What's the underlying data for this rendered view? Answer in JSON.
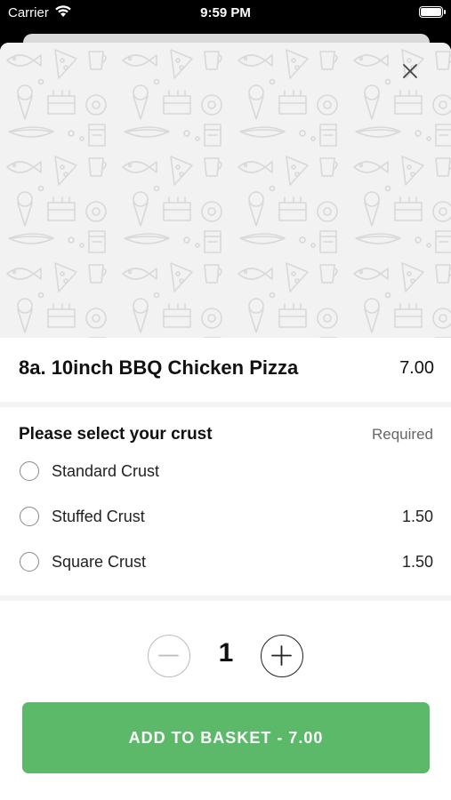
{
  "status_bar": {
    "carrier": "Carrier",
    "time": "9:59 PM"
  },
  "item": {
    "title": "8a. 10inch BBQ Chicken Pizza",
    "price": "7.00"
  },
  "crust": {
    "heading": "Please select your crust",
    "required_label": "Required",
    "options": [
      {
        "label": "Standard Crust",
        "price": ""
      },
      {
        "label": "Stuffed Crust",
        "price": "1.50"
      },
      {
        "label": "Square Crust",
        "price": "1.50"
      }
    ]
  },
  "quantity": {
    "value": "1"
  },
  "add_button": {
    "label": "ADD TO BASKET  -  7.00"
  },
  "colors": {
    "accent": "#5cb96a",
    "hero_bg": "#f2f2f2"
  }
}
